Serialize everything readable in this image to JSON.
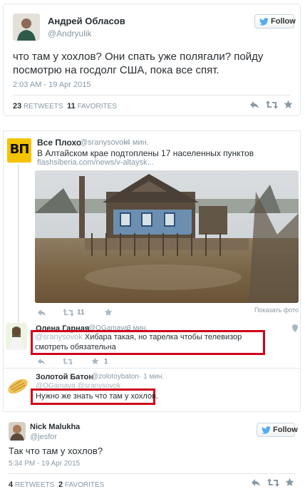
{
  "tweet1": {
    "name": "Андрей Обласов",
    "handle": "@Andryulik",
    "follow_label": "Follow",
    "text": "что там у хохлов? Они спать уже полягали? пойду посмотрю на госдолг США, пока все спят.",
    "time": "2:03 AM - 19 Apr 2015",
    "retweets_count": "23",
    "retweets_label": "RETWEETS",
    "favorites_count": "11",
    "favorites_label": "FAVORITES"
  },
  "thread": {
    "logo_text": "ВП",
    "main": {
      "name": "Все Плохо",
      "handle": "@sranysovok",
      "time": "· 4 мин.",
      "text": "В Алтайском крае подтоплены 17 населенных пунктов",
      "link": "flashsiberia.com/news/v-altaysk...",
      "retweets": "11",
      "show_photo": "Показать фото"
    },
    "reply1": {
      "name": "Олена Гарная",
      "handle": "@OGamaya",
      "time": "· 3 мин.",
      "mention": "@sranysovok",
      "text": "Хибара такая, но тарелка чтобы телевизор смотреть обязательна",
      "retweets": "",
      "favorites": "1"
    },
    "reply2": {
      "name": "Золотой Батон",
      "handle": "@zolotoybaton",
      "time": "· 1 мин.",
      "mention_line": "@OGamaya @sranysovok",
      "text": "Нужно же знать что там у хохлов."
    }
  },
  "tweet3": {
    "name": "Nick Malukha",
    "handle": "@jesfor",
    "follow_label": "Follow",
    "text": "Так что там у хохлов?",
    "time": "5:34 PM - 19 Apr 2015",
    "retweets_count": "4",
    "retweets_label": "RETWEETS",
    "favorites_count": "2",
    "favorites_label": "FAVORITES"
  },
  "colors": {
    "twitter_blue": "#55acee",
    "highlight_red": "#d0021b",
    "logo_yellow": "#f5c400"
  }
}
